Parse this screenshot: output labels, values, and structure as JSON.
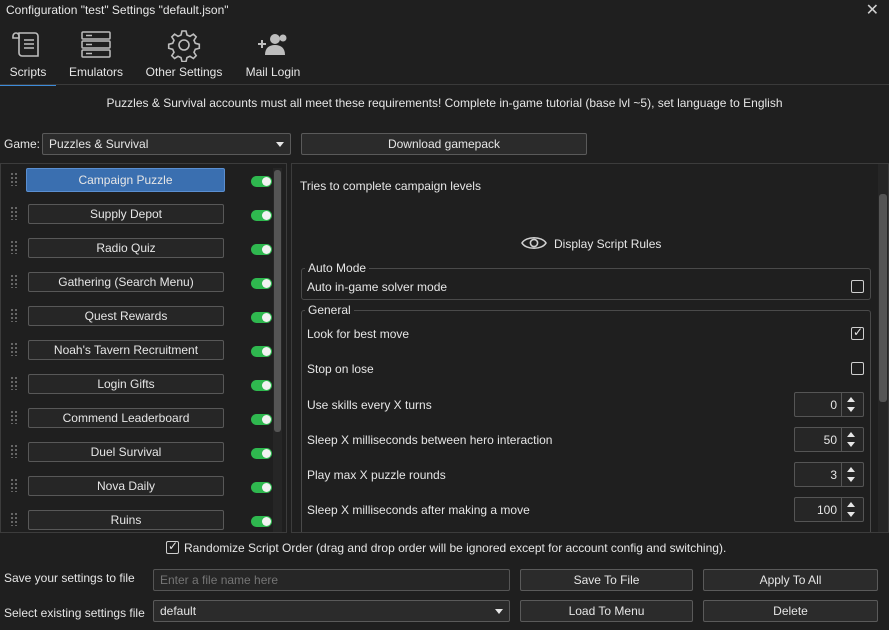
{
  "window": {
    "title": "Configuration \"test\" Settings \"default.json\""
  },
  "tabs": [
    {
      "label": "Scripts",
      "icon": "scroll-icon"
    },
    {
      "label": "Emulators",
      "icon": "server-stack-icon"
    },
    {
      "label": "Other Settings",
      "icon": "gear-icon"
    },
    {
      "label": "Mail Login",
      "icon": "add-user-icon"
    }
  ],
  "notice": "Puzzles & Survival accounts must all meet these requirements! Complete in-game tutorial (base lvl ~5), set language to English",
  "game": {
    "label": "Game:",
    "selected": "Puzzles & Survival",
    "download_label": "Download gamepack"
  },
  "scripts": [
    {
      "name": "Campaign Puzzle",
      "enabled": true,
      "selected": true
    },
    {
      "name": "Supply Depot",
      "enabled": true
    },
    {
      "name": "Radio Quiz",
      "enabled": true
    },
    {
      "name": "Gathering (Search Menu)",
      "enabled": true
    },
    {
      "name": "Quest Rewards",
      "enabled": true
    },
    {
      "name": "Noah's Tavern Recruitment",
      "enabled": true
    },
    {
      "name": "Login Gifts",
      "enabled": true
    },
    {
      "name": "Commend Leaderboard",
      "enabled": true
    },
    {
      "name": "Duel Survival",
      "enabled": true
    },
    {
      "name": "Nova Daily",
      "enabled": true
    },
    {
      "name": "Ruins",
      "enabled": true
    }
  ],
  "details": {
    "description": "Tries to complete campaign levels",
    "rules_label": "Display Script Rules",
    "auto_mode": {
      "title": "Auto Mode",
      "option_label": "Auto in-game solver mode",
      "checked": false
    },
    "general": {
      "title": "General",
      "best_move_label": "Look for best move",
      "best_move_checked": true,
      "stop_label": "Stop on lose",
      "stop_checked": false,
      "skills_label": "Use skills every X turns",
      "skills_value": "0",
      "hero_sleep_label": "Sleep X milliseconds between hero interaction",
      "hero_sleep_value": "50",
      "rounds_label": "Play max X puzzle rounds",
      "rounds_value": "3",
      "move_sleep_label": "Sleep X milliseconds after making a move",
      "move_sleep_value": "100"
    }
  },
  "randomize": {
    "label": "Randomize Script Order (drag and drop order will be ignored except for account config and switching).",
    "checked": true
  },
  "save": {
    "label": "Save your settings to file",
    "placeholder": "Enter a file name here",
    "save_button": "Save To File",
    "apply_button": "Apply To All"
  },
  "load": {
    "label": "Select existing settings file",
    "selected": "default",
    "load_button": "Load To Menu",
    "delete_button": "Delete"
  }
}
